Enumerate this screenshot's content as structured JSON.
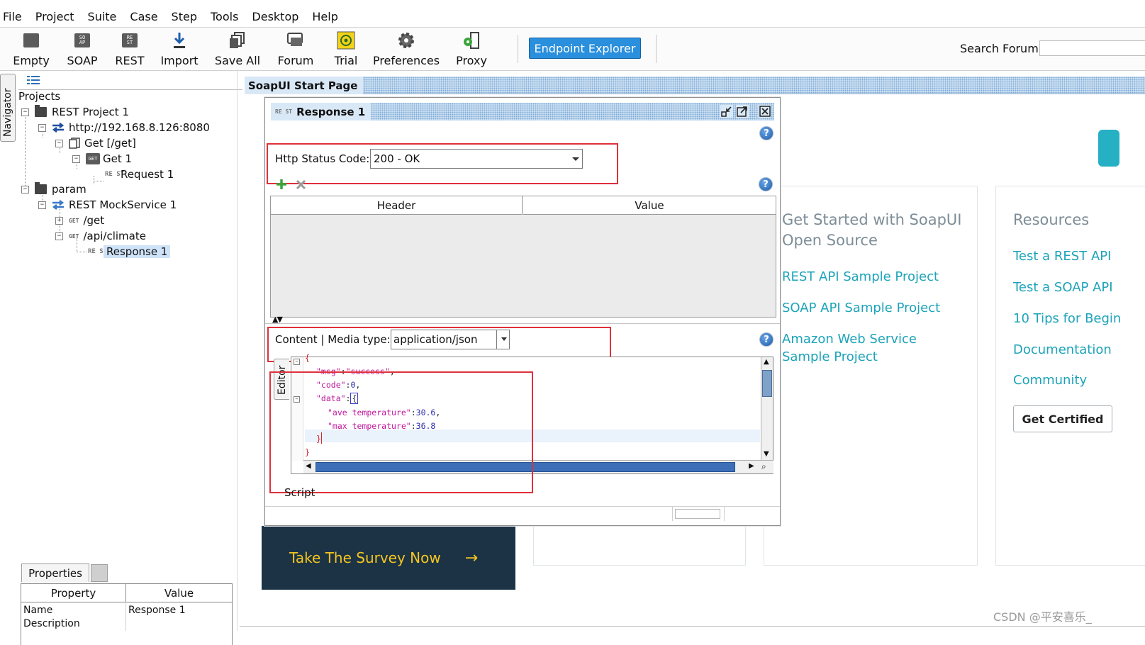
{
  "menu": [
    "File",
    "Project",
    "Suite",
    "Case",
    "Step",
    "Tools",
    "Desktop",
    "Help"
  ],
  "toolbar": {
    "buttons": [
      "Empty",
      "SOAP",
      "REST",
      "Import",
      "Save All",
      "Forum",
      "Trial",
      "Preferences",
      "Proxy"
    ],
    "endpoint_explorer": "Endpoint Explorer",
    "search_label": "Search Forum",
    "search_value": ""
  },
  "navigator": {
    "tab_label": "Navigator",
    "root": "Projects",
    "tree": [
      "REST Project 1",
      "http://192.168.8.126:8080",
      "Get [/get]",
      "Get 1",
      "Request 1",
      "param",
      "REST MockService 1",
      "/get",
      "/api/climate",
      "Response 1"
    ],
    "icon_labels": {
      "get": "GET",
      "rest": "RE ST"
    }
  },
  "properties": {
    "tab_label": "Properties",
    "columns": [
      "Property",
      "Value"
    ],
    "rows": [
      {
        "property": "Name",
        "value": "Response 1"
      },
      {
        "property": "Description",
        "value": ""
      }
    ]
  },
  "start_page": {
    "tab_label": "SoapUI Start Page",
    "getting_started_title": "Get Started with SoapUI Open Source",
    "getting_started_links": [
      "REST API Sample Project",
      "SOAP API Sample Project",
      "Amazon Web Service Sample Project"
    ],
    "resources_title": "Resources",
    "resources_links": [
      "Test a REST API",
      "Test a SOAP API",
      "10 Tips for Begin",
      "Documentation",
      "Community"
    ],
    "cert_button": "Get Certified",
    "survey_text": "Take The Survey Now",
    "survey_arrow": "→"
  },
  "response_window": {
    "title": "Response 1",
    "status_label": "Http Status Code:",
    "status_value": "200 - OK",
    "header_columns": [
      "Header",
      "Value"
    ],
    "content_label": "Content | Media type:",
    "media_type": "application/json",
    "editor_tab": "Editor",
    "script_label": "Script",
    "code": {
      "open": "{",
      "msg_key": "\"msg\"",
      "msg_val": "\"success\"",
      "code_key": "\"code\"",
      "code_val": "0",
      "data_key": "\"data\"",
      "data_open": "{",
      "ave_key": "\"ave temperature\"",
      "ave_val": "30.6",
      "max_key": "\"max temperature\"",
      "max_val": "36.8",
      "data_close": "}",
      "close": "}"
    }
  },
  "watermark": "CSDN @平安喜乐_",
  "colors": {
    "accent": "#2a8fdc",
    "link": "#1da3b9",
    "highlight": "#e0303a",
    "survey_bg": "#1b3345",
    "survey_text": "#f5c51f"
  }
}
